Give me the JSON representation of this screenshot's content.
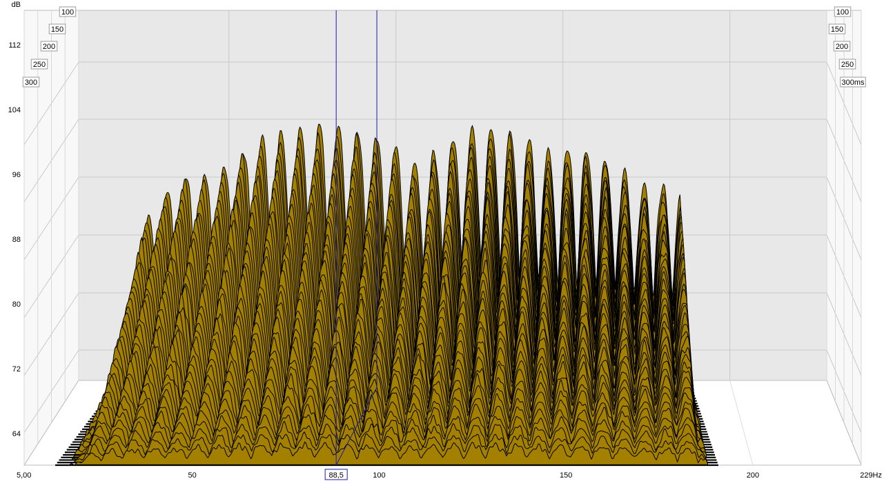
{
  "chart_data": {
    "type": "area",
    "subtype": "waterfall-3d",
    "xlabel_unit": "Hz",
    "ylabel_unit": "dB",
    "depth_unit": "ms",
    "x_range": [
      5,
      229
    ],
    "y_range": [
      60,
      117
    ],
    "depth_range": [
      100,
      300
    ],
    "x_ticks": [
      "5,00",
      "50",
      "100",
      "150",
      "200",
      "229Hz"
    ],
    "y_ticks": [
      "112",
      "104",
      "96",
      "88",
      "80",
      "72",
      "64"
    ],
    "depth_ticks_left": [
      "100",
      "150",
      "200",
      "250",
      "300"
    ],
    "depth_ticks_right": [
      "100",
      "150",
      "200",
      "250",
      "300ms"
    ],
    "cursor_label": "88,5",
    "cursor_frequency": 88.5,
    "colors": {
      "fill": "#a38000",
      "slice_line": "#000000",
      "back_wall": "#e8e8e8",
      "grid": "#c8c8c8",
      "cursor": "#1a1aa0"
    },
    "data_range": {
      "freq_start": 17,
      "freq_end": 188
    },
    "envelope_peaks": [
      {
        "freq": 40,
        "db": 93.7
      },
      {
        "freq": 68,
        "db": 99.6
      },
      {
        "freq": 75,
        "db": 100.3
      },
      {
        "freq": 80,
        "db": 100.2
      },
      {
        "freq": 86,
        "db": 100.0
      },
      {
        "freq": 128,
        "db": 100.2
      },
      {
        "freq": 152,
        "db": 97.2
      },
      {
        "freq": 178,
        "db": 92.0
      }
    ]
  }
}
